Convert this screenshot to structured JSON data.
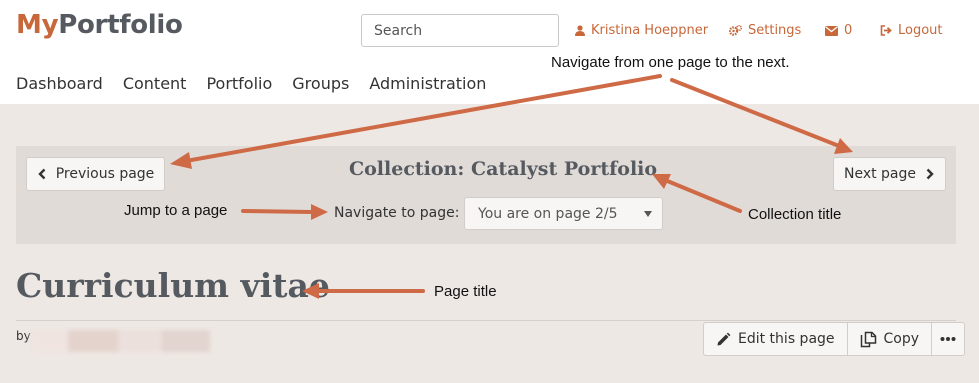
{
  "brand": {
    "part1": "My",
    "part2": "Portfolio"
  },
  "search": {
    "placeholder": "Search"
  },
  "user_links": {
    "user_name": "Kristina Hoeppner",
    "settings": "Settings",
    "messages": "0",
    "logout": "Logout"
  },
  "main_nav": [
    "Dashboard",
    "Content",
    "Portfolio",
    "Groups",
    "Administration"
  ],
  "collection": {
    "prev_label": "Previous page",
    "next_label": "Next page",
    "title": "Collection: Catalyst Portfolio",
    "navigate_label": "Navigate to page:",
    "selected_page": "You are on page 2/5"
  },
  "page": {
    "title": "Curriculum vitae",
    "by_label": "by",
    "edit_label": "Edit this page",
    "copy_label": "Copy"
  },
  "annotations": {
    "navigate": "Navigate from one page to the next.",
    "jump": "Jump to a page",
    "collection_title": "Collection title",
    "page_title": "Page title"
  },
  "colors": {
    "accent": "#c8673a",
    "arrow": "#cf6a47",
    "band": "#eee8e4",
    "collection_box": "#e1dbd7",
    "heading": "#555a60"
  },
  "icons": [
    "user-icon",
    "gears-icon",
    "envelope-icon",
    "logout-icon",
    "chevron-left-icon",
    "chevron-right-icon",
    "caret-down-icon",
    "pencil-icon",
    "copy-icon",
    "ellipsis-icon"
  ]
}
